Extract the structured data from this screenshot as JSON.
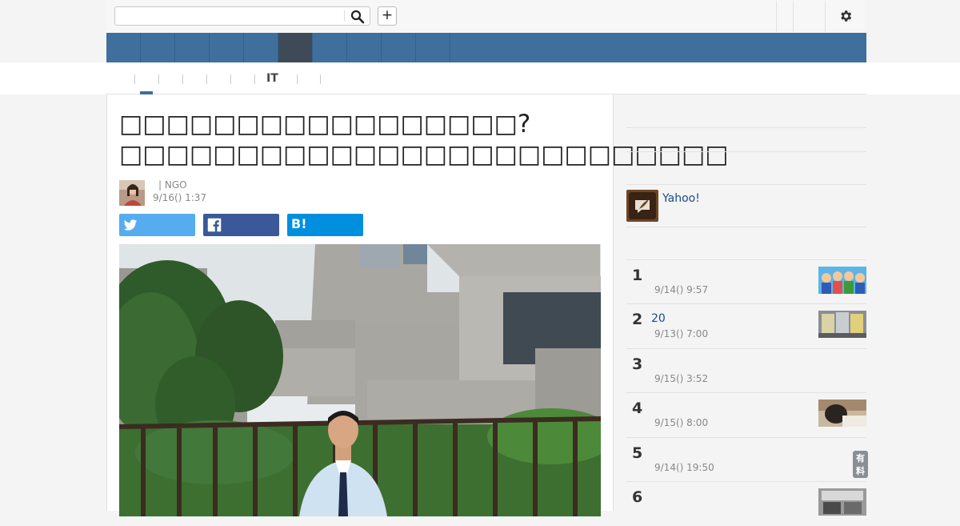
{
  "search": {
    "value": "",
    "placeholder": ""
  },
  "add_button": {
    "label": "+"
  },
  "subnav": {
    "it_label": "IT"
  },
  "article": {
    "title": "□□□□□□□□□□□□□□□□□? □□□□□□□□□□□□□□□□□□□□□□□□□□",
    "author": "| NGO",
    "date": "9/16() 1:37"
  },
  "share": {
    "hatena_label": "B!"
  },
  "sidebar": {
    "yahoo_text": "Yahoo!",
    "ranking": [
      {
        "rank": "1",
        "title": "",
        "date": "9/14() 9:57",
        "badge": ""
      },
      {
        "rank": "2",
        "title": "20",
        "date": "9/13() 7:00",
        "badge": ""
      },
      {
        "rank": "3",
        "title": "",
        "date": "9/15() 3:52",
        "badge": ""
      },
      {
        "rank": "4",
        "title": "",
        "date": "9/15() 8:00",
        "badge": ""
      },
      {
        "rank": "5",
        "title": "",
        "date": "9/14() 19:50",
        "badge": "有料"
      },
      {
        "rank": "6",
        "title": "",
        "date": "",
        "badge": ""
      }
    ]
  },
  "colors": {
    "nav_blue": "#3f6f9c",
    "nav_active": "#3f4a58",
    "twitter": "#55acee",
    "facebook": "#3b5998",
    "hatena": "#008fde",
    "link": "#1a4b8c",
    "badge_gray": "#8a8f94"
  },
  "icons": [
    "search-icon",
    "plus-icon",
    "gear-icon",
    "twitter-icon",
    "facebook-icon",
    "hatena-icon",
    "yahoo-news-icon"
  ]
}
